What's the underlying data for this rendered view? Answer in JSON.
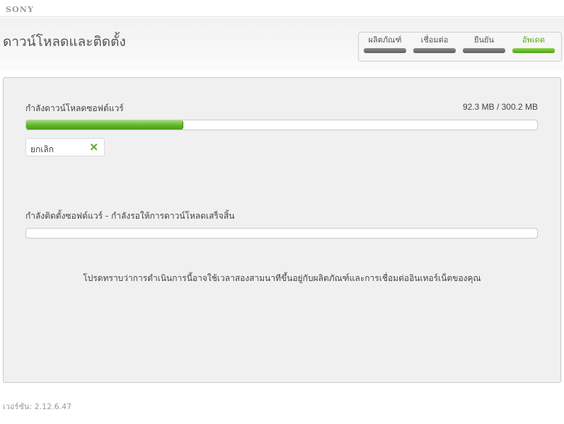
{
  "brand": {
    "logo": "SONY"
  },
  "header": {
    "title": "ดาวน์โหลดและติดตั้ง"
  },
  "steps": [
    {
      "label": "ผลิตภัณฑ์",
      "active": false
    },
    {
      "label": "เชื่อมต่อ",
      "active": false
    },
    {
      "label": "ยืนยัน",
      "active": false
    },
    {
      "label": "อัพเดต",
      "active": true
    }
  ],
  "download": {
    "label": "กำลังดาวน์โหลดซอฟต์แวร์",
    "size_text": "92.3 MB / 300.2 MB",
    "progress_fraction": 0.3075
  },
  "cancel": {
    "label": "ยกเลิก",
    "icon": "close-icon"
  },
  "install": {
    "label": "กำลังติดตั้งซอฟต์แวร์ - กำลังรอให้การดาวน์โหลดเสร็จสิ้น",
    "progress_fraction": 0
  },
  "notice": "โปรดทราบว่าการดำเนินการนี้อาจใช้เวลาสองสามนาทีขึ้นอยู่กับผลิตภัณฑ์และการเชื่อมต่ออินเทอร์เน็ตของคุณ",
  "footer": {
    "version": "เวอร์ชัน: 2.12.6.47"
  },
  "colors": {
    "accent_green": "#5aab1f",
    "inactive_step": "#666666",
    "panel_bg": "#f0f0f0"
  }
}
